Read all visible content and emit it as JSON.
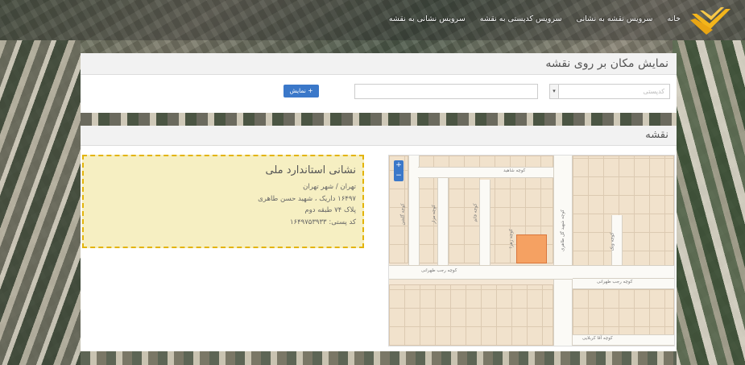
{
  "nav": {
    "items": [
      "خانه",
      "سرویس نقشه به نشانی",
      "سرویس کدپستی به نقشه",
      "سرویس نشانی به نقشه"
    ]
  },
  "search_panel": {
    "title": "نمایش مکان بر روی نقشه",
    "select_placeholder": "کدپستی",
    "input_value": "",
    "button_label": "نمایش +"
  },
  "map_panel": {
    "title": "نقشه",
    "address": {
      "title": "نشانی استاندارد ملی",
      "lines": [
        "تهران / شهر تهران",
        "۱۶۴۹۷ داریک ، شهید حسن طاهری",
        "پلاک ۷۴ طبقه دوم",
        "کد پستی: ۱۶۴۹۷۵۳۹۳۳"
      ]
    },
    "map": {
      "zoom_in": "+",
      "zoom_out": "−",
      "road_labels": [
        "کوچه شاهید",
        "کوچه شهید گل طاهری",
        "کوچه رجب طهرانی",
        "کوچه رجب طهرانی",
        "کوچه گلشن",
        "کوچه مزار",
        "کوچه قائم",
        "کوچه ونک",
        "کوچه زهرا",
        "کوچه آقا کربلایی"
      ]
    }
  },
  "colors": {
    "accent": "#3b78c9",
    "highlight_parcel": "#f5a162",
    "address_border": "#e3b40a",
    "address_bg": "#f6efc2"
  }
}
